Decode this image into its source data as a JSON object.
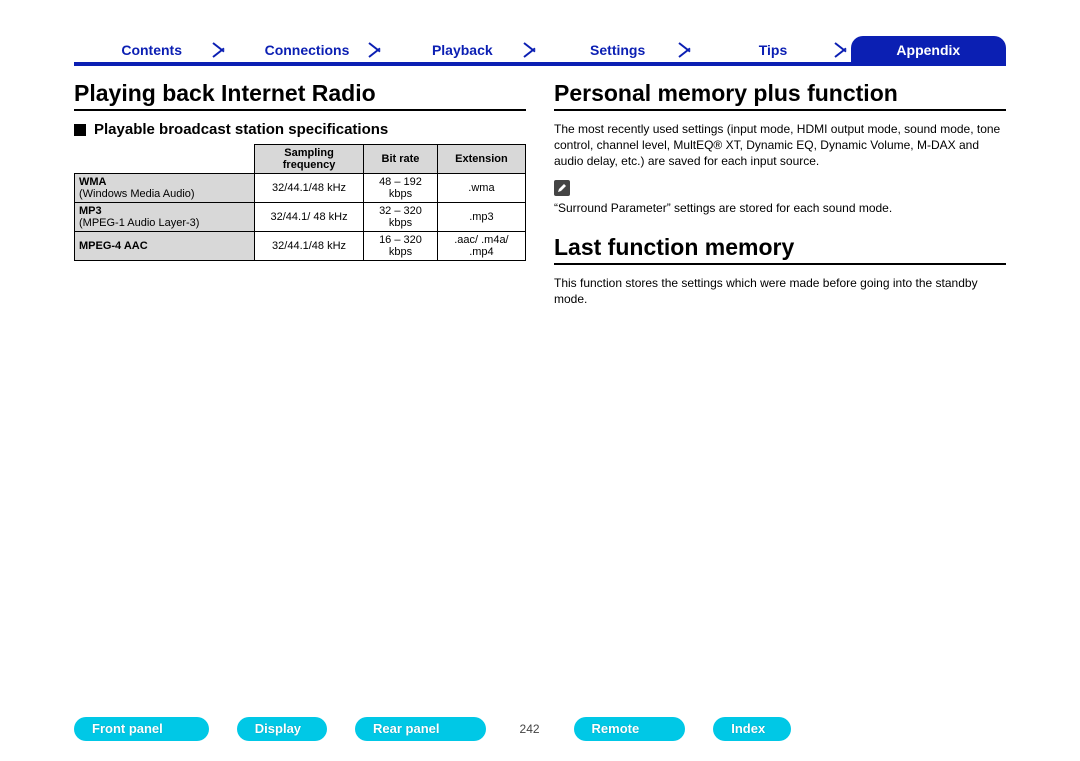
{
  "top_tabs": {
    "contents": "Contents",
    "connections": "Connections",
    "playback": "Playback",
    "settings": "Settings",
    "tips": "Tips",
    "appendix": "Appendix"
  },
  "left": {
    "title": "Playing back Internet Radio",
    "subhead": "Playable broadcast station specifications",
    "table": {
      "headers": {
        "c1": "Sampling frequency",
        "c2": "Bit rate",
        "c3": "Extension"
      },
      "rows": [
        {
          "fmt_b": "WMA",
          "fmt_sub": "(Windows Media Audio)",
          "sf": "32/44.1/48 kHz",
          "br": "48 – 192 kbps",
          "ext": ".wma"
        },
        {
          "fmt_b": "MP3",
          "fmt_sub": "(MPEG-1 Audio Layer-3)",
          "sf": "32/44.1/ 48 kHz",
          "br": "32 – 320 kbps",
          "ext": ".mp3"
        },
        {
          "fmt_b": "MPEG-4 AAC",
          "fmt_sub": "",
          "sf": "32/44.1/48 kHz",
          "br": "16 – 320 kbps",
          "ext": ".aac/ .m4a/ .mp4"
        }
      ]
    }
  },
  "right": {
    "title1": "Personal memory plus function",
    "para1": "The most recently used settings (input mode, HDMI output mode, sound mode, tone control, channel level, MultEQ® XT, Dynamic EQ, Dynamic Volume, M-DAX and audio delay, etc.) are saved for each input source.",
    "note": "“Surround Parameter” settings are stored for each sound mode.",
    "title2": "Last function memory",
    "para2": "This function stores the settings which were made before going into the standby mode."
  },
  "bottom": {
    "front": "Front panel",
    "display": "Display",
    "rear": "Rear panel",
    "page": "242",
    "remote": "Remote",
    "index": "Index"
  }
}
